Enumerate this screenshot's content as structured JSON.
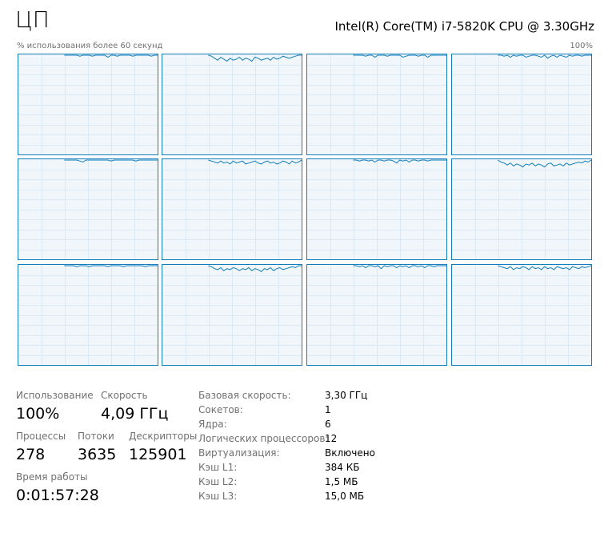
{
  "header": {
    "title": "ЦП",
    "cpu_name": "Intel(R) Core(TM) i7-5820K CPU @ 3.30GHz",
    "utilization_label": "% использования более 60 секунд",
    "max_label": "100%"
  },
  "colors": {
    "graph_border": "#117dbb",
    "graph_fill": "#f1f6fa",
    "graph_grid": "#d9eaf4",
    "graph_line": "#117dbb",
    "label_gray": "#707070"
  },
  "graphs": {
    "count": 12,
    "columns": 4,
    "rows": 3,
    "levels": [
      [
        100,
        100,
        100,
        100,
        100,
        99,
        100,
        100,
        100,
        99,
        100,
        100,
        100,
        100,
        98,
        100,
        100,
        99,
        100,
        100,
        100,
        100,
        99,
        100,
        100,
        100,
        100,
        100,
        99,
        100,
        100
      ],
      [
        100,
        99,
        97,
        95,
        98,
        96,
        94,
        97,
        95,
        96,
        98,
        95,
        97,
        96,
        94,
        98,
        97,
        95,
        96,
        97,
        95,
        98,
        96,
        97,
        99,
        98,
        97,
        98,
        99,
        100,
        100
      ],
      [
        100,
        100,
        100,
        100,
        99,
        100,
        100,
        98,
        100,
        100,
        100,
        99,
        100,
        100,
        100,
        100,
        98,
        99,
        100,
        100,
        100,
        99,
        100,
        100,
        98,
        100,
        100,
        100,
        100,
        100,
        100
      ],
      [
        100,
        100,
        99,
        100,
        98,
        100,
        99,
        100,
        100,
        98,
        99,
        100,
        100,
        99,
        98,
        100,
        97,
        99,
        100,
        98,
        100,
        99,
        98,
        100,
        99,
        100,
        100,
        99,
        100,
        100,
        100
      ],
      [
        100,
        100,
        100,
        100,
        100,
        99,
        98,
        100,
        100,
        100,
        100,
        100,
        100,
        100,
        100,
        99,
        100,
        100,
        100,
        100,
        100,
        100,
        100,
        99,
        100,
        100,
        100,
        100,
        100,
        100,
        100
      ],
      [
        100,
        99,
        98,
        97,
        99,
        97,
        98,
        96,
        99,
        97,
        98,
        99,
        96,
        97,
        98,
        99,
        97,
        96,
        98,
        99,
        97,
        98,
        96,
        97,
        99,
        98,
        96,
        99,
        97,
        98,
        100
      ],
      [
        100,
        100,
        99,
        100,
        100,
        99,
        100,
        98,
        100,
        100,
        99,
        100,
        100,
        99,
        97,
        100,
        99,
        100,
        98,
        100,
        100,
        99,
        100,
        100,
        99,
        100,
        100,
        100,
        100,
        100,
        100
      ],
      [
        100,
        98,
        97,
        95,
        97,
        94,
        96,
        95,
        93,
        96,
        95,
        97,
        94,
        96,
        95,
        93,
        96,
        97,
        94,
        95,
        96,
        94,
        97,
        95,
        96,
        97,
        98,
        97,
        99,
        98,
        100
      ],
      [
        100,
        100,
        100,
        100,
        99,
        100,
        100,
        100,
        99,
        100,
        100,
        100,
        100,
        100,
        99,
        100,
        100,
        100,
        100,
        99,
        100,
        100,
        100,
        100,
        100,
        100,
        99,
        100,
        100,
        100,
        100
      ],
      [
        100,
        99,
        97,
        96,
        98,
        95,
        97,
        96,
        98,
        97,
        95,
        97,
        96,
        98,
        95,
        97,
        96,
        94,
        97,
        96,
        98,
        95,
        97,
        98,
        96,
        97,
        98,
        99,
        98,
        100,
        100
      ],
      [
        100,
        100,
        99,
        100,
        98,
        100,
        100,
        99,
        100,
        97,
        100,
        99,
        100,
        100,
        98,
        100,
        99,
        100,
        98,
        100,
        100,
        99,
        100,
        98,
        100,
        100,
        99,
        100,
        100,
        100,
        100
      ],
      [
        100,
        99,
        98,
        97,
        99,
        96,
        98,
        97,
        99,
        98,
        96,
        99,
        97,
        98,
        96,
        99,
        97,
        98,
        96,
        99,
        98,
        97,
        98,
        96,
        99,
        98,
        97,
        99,
        98,
        99,
        100
      ]
    ]
  },
  "stats": {
    "usage_label": "Использование",
    "usage_value": "100%",
    "speed_label": "Скорость",
    "speed_value": "4,09 ГГц",
    "processes_label": "Процессы",
    "processes_value": "278",
    "threads_label": "Потоки",
    "threads_value": "3635",
    "handles_label": "Дескрипторы",
    "handles_value": "125901",
    "uptime_label": "Время работы",
    "uptime_value": "0:01:57:28"
  },
  "info": [
    {
      "label": "Базовая скорость:",
      "value": "3,30 ГГц"
    },
    {
      "label": "Сокетов:",
      "value": "1"
    },
    {
      "label": "Ядра:",
      "value": "6"
    },
    {
      "label": "Логических процессоров:",
      "value": "12"
    },
    {
      "label": "Виртуализация:",
      "value": "Включено"
    },
    {
      "label": "Кэш L1:",
      "value": "384 КБ"
    },
    {
      "label": "Кэш L2:",
      "value": "1,5 МБ"
    },
    {
      "label": "Кэш L3:",
      "value": "15,0 МБ"
    }
  ]
}
